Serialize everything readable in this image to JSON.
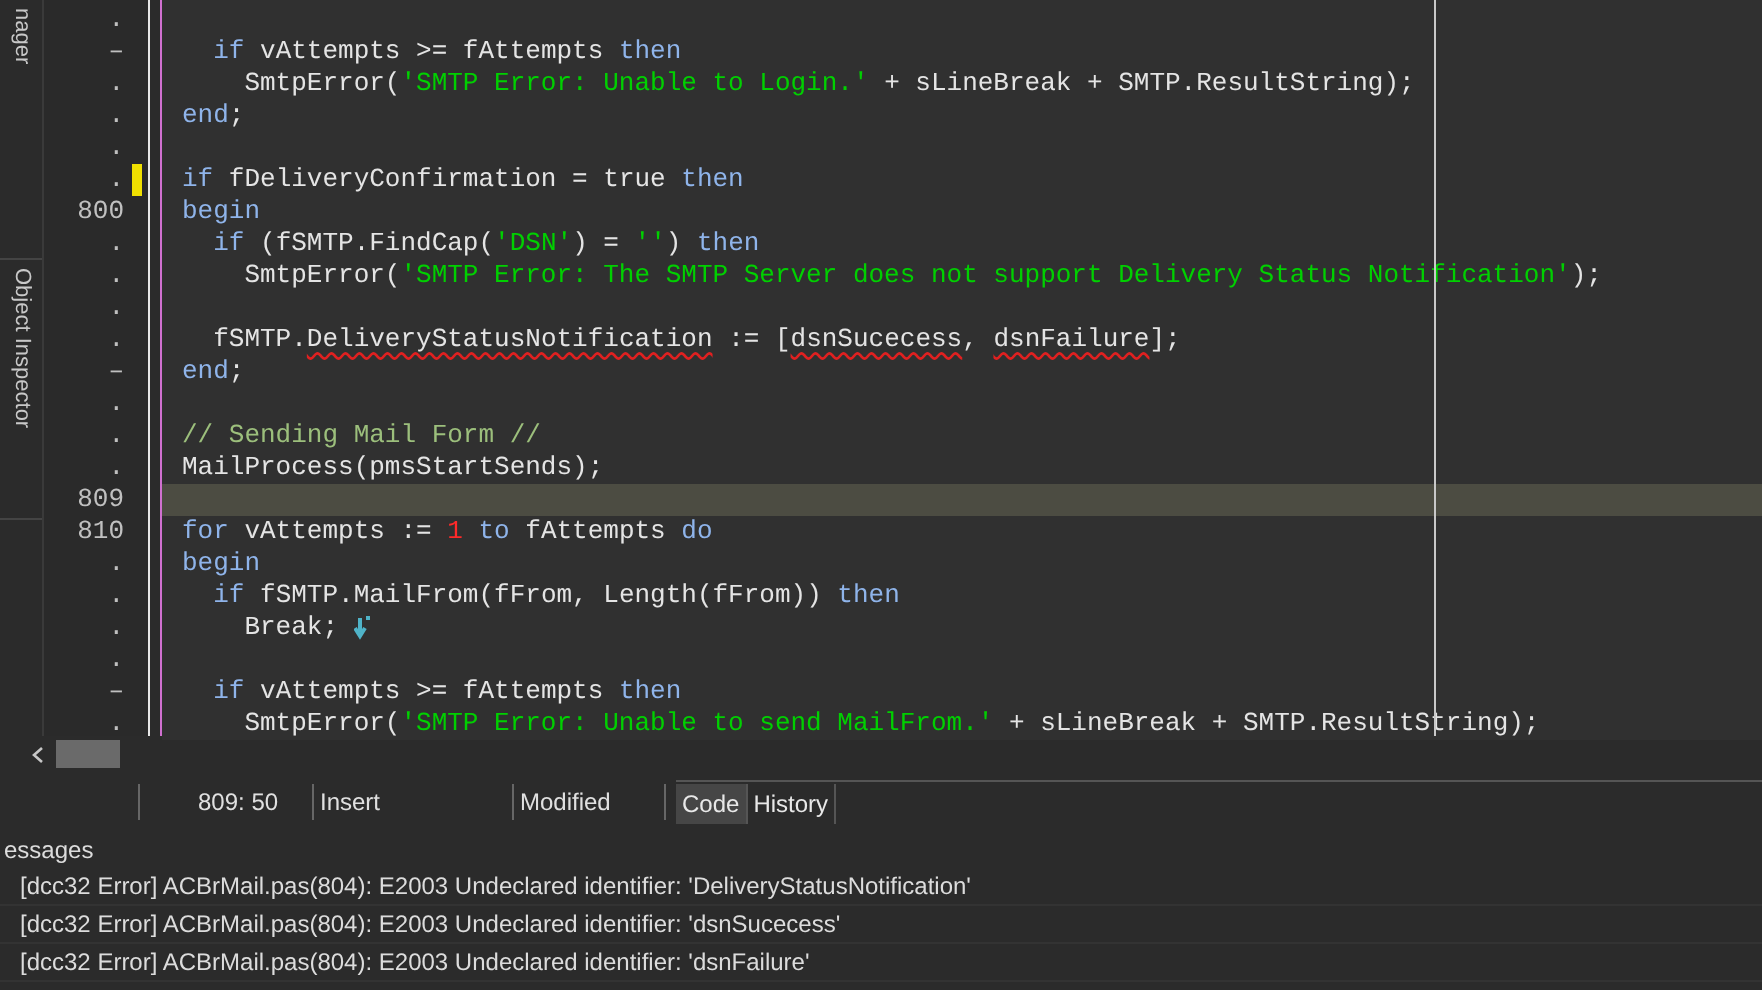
{
  "side_tabs": [
    "nager",
    "Object Inspector"
  ],
  "editor": {
    "lines": [
      {
        "gutter": ".",
        "current": false,
        "modified": false
      },
      {
        "gutter": "–",
        "current": false,
        "modified": false,
        "tokens": [
          {
            "kind": "keyword",
            "text": "  if"
          },
          {
            "kind": "plain",
            "text": " vAttempts >= fAttempts "
          },
          {
            "kind": "keyword",
            "text": "then"
          }
        ]
      },
      {
        "gutter": ".",
        "current": false,
        "modified": false,
        "tokens": [
          {
            "kind": "plain",
            "text": "    SmtpError("
          },
          {
            "kind": "string",
            "text": "'SMTP Error: Unable to Login.'"
          },
          {
            "kind": "plain",
            "text": " + sLineBreak + SMTP.ResultString);"
          }
        ]
      },
      {
        "gutter": ".",
        "current": false,
        "modified": false,
        "tokens": [
          {
            "kind": "keyword",
            "text": "end"
          },
          {
            "kind": "plain",
            "text": ";"
          }
        ]
      },
      {
        "gutter": ".",
        "current": false,
        "modified": false
      },
      {
        "gutter": ".",
        "current": false,
        "modified": true,
        "tokens": [
          {
            "kind": "keyword",
            "text": "if"
          },
          {
            "kind": "plain",
            "text": " fDeliveryConfirmation = true "
          },
          {
            "kind": "keyword",
            "text": "then"
          }
        ]
      },
      {
        "gutter": "800",
        "current": false,
        "modified": false,
        "tokens": [
          {
            "kind": "keyword",
            "text": "begin"
          }
        ]
      },
      {
        "gutter": ".",
        "current": false,
        "modified": false,
        "tokens": [
          {
            "kind": "keyword",
            "text": "  if"
          },
          {
            "kind": "plain",
            "text": " (fSMTP.FindCap("
          },
          {
            "kind": "string",
            "text": "'DSN'"
          },
          {
            "kind": "plain",
            "text": ") = "
          },
          {
            "kind": "string",
            "text": "''"
          },
          {
            "kind": "plain",
            "text": ") "
          },
          {
            "kind": "keyword",
            "text": "then"
          }
        ]
      },
      {
        "gutter": ".",
        "current": false,
        "modified": false,
        "tokens": [
          {
            "kind": "plain",
            "text": "    SmtpError("
          },
          {
            "kind": "string",
            "text": "'SMTP Error: The SMTP Server does not support Delivery Status Notification'"
          },
          {
            "kind": "plain",
            "text": ");"
          }
        ]
      },
      {
        "gutter": ".",
        "current": false,
        "modified": false
      },
      {
        "gutter": ".",
        "current": false,
        "modified": false,
        "tokens": [
          {
            "kind": "plain",
            "text": "  fSMTP."
          },
          {
            "kind": "error",
            "text": "DeliveryStatusNotification"
          },
          {
            "kind": "plain",
            "text": " := ["
          },
          {
            "kind": "error",
            "text": "dsnSucecess"
          },
          {
            "kind": "plain",
            "text": ", "
          },
          {
            "kind": "error",
            "text": "dsnFailure"
          },
          {
            "kind": "plain",
            "text": "];"
          }
        ]
      },
      {
        "gutter": "–",
        "current": false,
        "modified": false,
        "tokens": [
          {
            "kind": "keyword",
            "text": "end"
          },
          {
            "kind": "plain",
            "text": ";"
          }
        ]
      },
      {
        "gutter": ".",
        "current": false,
        "modified": false
      },
      {
        "gutter": ".",
        "current": false,
        "modified": false,
        "tokens": [
          {
            "kind": "comment",
            "text": "// Sending Mail Form //"
          }
        ]
      },
      {
        "gutter": ".",
        "current": false,
        "modified": false,
        "tokens": [
          {
            "kind": "plain",
            "text": "MailProcess(pmsStartSends);"
          }
        ]
      },
      {
        "gutter": "809",
        "current": true,
        "modified": false
      },
      {
        "gutter": "810",
        "current": false,
        "modified": false,
        "tokens": [
          {
            "kind": "keyword",
            "text": "for"
          },
          {
            "kind": "plain",
            "text": " vAttempts := "
          },
          {
            "kind": "number",
            "text": "1"
          },
          {
            "kind": "keyword",
            "text": " to"
          },
          {
            "kind": "plain",
            "text": " fAttempts "
          },
          {
            "kind": "keyword",
            "text": "do"
          }
        ]
      },
      {
        "gutter": ".",
        "current": false,
        "modified": false,
        "tokens": [
          {
            "kind": "keyword",
            "text": "begin"
          }
        ]
      },
      {
        "gutter": ".",
        "current": false,
        "modified": false,
        "tokens": [
          {
            "kind": "keyword",
            "text": "  if"
          },
          {
            "kind": "plain",
            "text": " fSMTP.MailFrom(fFrom, Length(fFrom)) "
          },
          {
            "kind": "keyword",
            "text": "then"
          }
        ]
      },
      {
        "gutter": ".",
        "current": false,
        "modified": false,
        "tokens": [
          {
            "kind": "plain",
            "text": "    Break;"
          },
          {
            "kind": "flow"
          }
        ]
      },
      {
        "gutter": ".",
        "current": false,
        "modified": false
      },
      {
        "gutter": "–",
        "current": false,
        "modified": false,
        "tokens": [
          {
            "kind": "keyword",
            "text": "  if"
          },
          {
            "kind": "plain",
            "text": " vAttempts >= fAttempts "
          },
          {
            "kind": "keyword",
            "text": "then"
          }
        ]
      },
      {
        "gutter": ".",
        "current": false,
        "modified": false,
        "tokens": [
          {
            "kind": "plain",
            "text": "    SmtpError("
          },
          {
            "kind": "string",
            "text": "'SMTP Error: Unable to send MailFrom.'"
          },
          {
            "kind": "plain",
            "text": " + sLineBreak + SMTP.ResultString);"
          }
        ]
      }
    ]
  },
  "status_bar": {
    "position": "809: 50",
    "mode": "Insert",
    "state": "Modified",
    "tabs": [
      {
        "label": "Code",
        "selected": true
      },
      {
        "label": "History",
        "selected": false
      }
    ]
  },
  "messages": {
    "title": "essages",
    "items": [
      "[dcc32 Error] ACBrMail.pas(804): E2003 Undeclared identifier: 'DeliveryStatusNotification'",
      "[dcc32 Error] ACBrMail.pas(804): E2003 Undeclared identifier: 'dsnSucecess'",
      "[dcc32 Error] ACBrMail.pas(804): E2003 Undeclared identifier: 'dsnFailure'"
    ]
  }
}
